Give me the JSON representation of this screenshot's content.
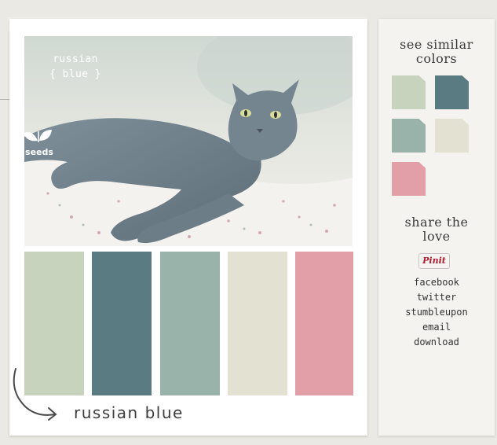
{
  "palette": {
    "name": "russian blue",
    "photo_title_line1": "russian",
    "photo_title_line2": "{ blue }",
    "logo_text": "seeds",
    "swatches": [
      {
        "color": "#c8d3bd"
      },
      {
        "color": "#5b7b82"
      },
      {
        "color": "#99b3aa"
      },
      {
        "color": "#e2e1d2"
      },
      {
        "color": "#e39fa8"
      }
    ]
  },
  "sidebar": {
    "similar_heading_line1": "see similar",
    "similar_heading_line2": "colors",
    "similar": [
      {
        "color": "#c8d3bd"
      },
      {
        "color": "#5b7b82"
      },
      {
        "color": "#99b3aa"
      },
      {
        "color": "#e2e1d2"
      },
      {
        "color": "#e39fa8"
      }
    ],
    "share_heading_line1": "share the",
    "share_heading_line2": "love",
    "pinit_label": "Pinit",
    "links": [
      "facebook",
      "twitter",
      "stumbleupon",
      "email",
      "download"
    ]
  }
}
